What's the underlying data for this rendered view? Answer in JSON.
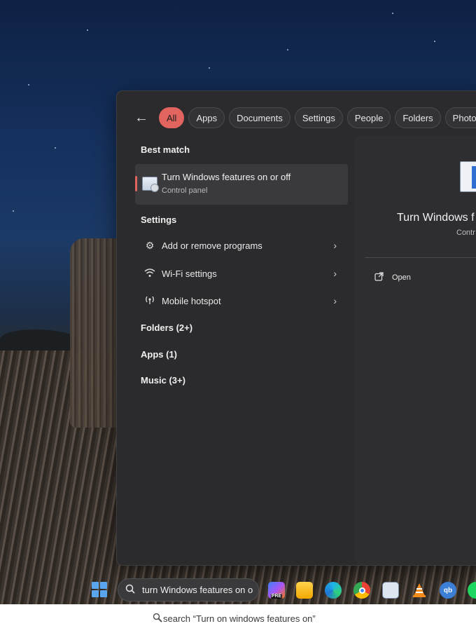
{
  "filters": {
    "back_icon": "arrow-left-icon",
    "chips": [
      "All",
      "Apps",
      "Documents",
      "Settings",
      "People",
      "Folders",
      "Photos"
    ],
    "active": "All"
  },
  "best_match": {
    "heading": "Best match",
    "title": "Turn Windows features on or off",
    "subtitle": "Control panel",
    "icon": "control-panel-icon"
  },
  "settings": {
    "heading": "Settings",
    "items": [
      {
        "label": "Add or remove programs",
        "icon": "gear-icon"
      },
      {
        "label": "Wi-Fi settings",
        "icon": "wifi-icon"
      },
      {
        "label": "Mobile hotspot",
        "icon": "hotspot-icon"
      }
    ]
  },
  "groups": [
    "Folders (2+)",
    "Apps (1)",
    "Music (3+)"
  ],
  "preview": {
    "title": "Turn Windows f",
    "subtitle": "Contr",
    "open_label": "Open",
    "open_icon": "open-external-icon"
  },
  "taskbar": {
    "search_text": "turn Windows features on o",
    "search_icon": "search-icon",
    "apps": [
      "copilot-icon",
      "file-explorer-icon",
      "edge-icon",
      "chrome-icon",
      "resource-monitor-icon",
      "vlc-icon",
      "qbittorrent-icon",
      "spotify-icon"
    ],
    "qb_label": "qb",
    "pre_label": "PRE"
  },
  "caption": "search “Turn on windows features on”",
  "colors": {
    "accent": "#e2645f",
    "panel": "#2b2b2d",
    "windows_blue": "#5aa6ee"
  }
}
